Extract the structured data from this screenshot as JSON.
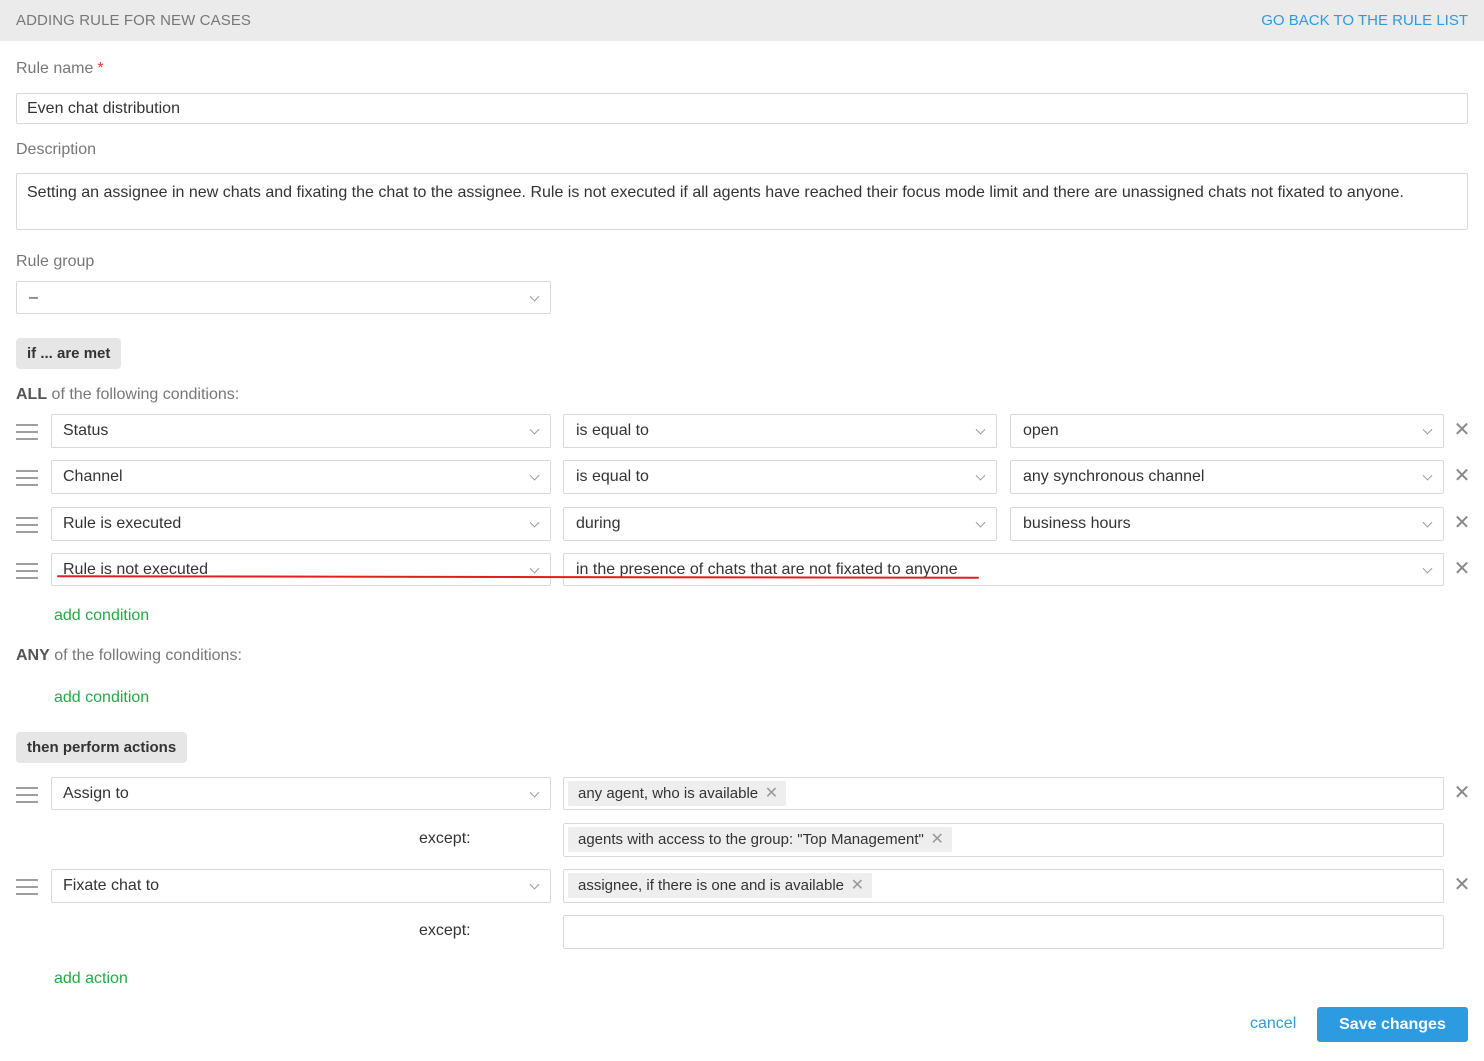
{
  "header": {
    "title": "ADDING RULE FOR NEW CASES",
    "back_link": "GO BACK TO THE RULE LIST"
  },
  "form": {
    "rule_name_label": "Rule name",
    "required_mark": "*",
    "rule_name_value": "Even chat distribution",
    "description_label": "Description",
    "description_value": "Setting an assignee in new chats and fixating the chat to the assignee. Rule is not executed if all agents have reached their focus mode limit and there are unassigned chats not fixated to anyone.",
    "rule_group_label": "Rule group",
    "rule_group_value": "–"
  },
  "conditions": {
    "badge": "if ... are met",
    "all_prefix": "ALL",
    "all_suffix": " of the following conditions:",
    "rows": [
      {
        "field": "Status",
        "operator": "is equal to",
        "value": "open"
      },
      {
        "field": "Channel",
        "operator": "is equal to",
        "value": "any synchronous channel"
      },
      {
        "field": "Rule is executed",
        "operator": "during",
        "value": "business hours"
      },
      {
        "field": "Rule is not executed",
        "operator": "in the presence of chats that are not fixated to anyone"
      }
    ],
    "add_condition": "add condition",
    "any_prefix": "ANY",
    "any_suffix": " of the following conditions:",
    "add_condition_any": "add condition"
  },
  "actions": {
    "badge": "then perform actions",
    "rows": [
      {
        "action": "Assign to",
        "tag": "any agent, who is available",
        "except_label": "except:",
        "except_tag": "agents with access to the group: \"Top Management\""
      },
      {
        "action": "Fixate chat to",
        "tag": "assignee, if there is one and is available",
        "except_label": "except:",
        "except_tag": ""
      }
    ],
    "add_action": "add action"
  },
  "footer": {
    "cancel": "cancel",
    "save": "Save changes"
  },
  "icons": {
    "chevron": "chevron-down-icon",
    "remove": "close-icon",
    "drag": "drag-handle-icon"
  },
  "colors": {
    "accent": "#2d9be0",
    "green": "#27a744",
    "annotation": "#e02020"
  }
}
